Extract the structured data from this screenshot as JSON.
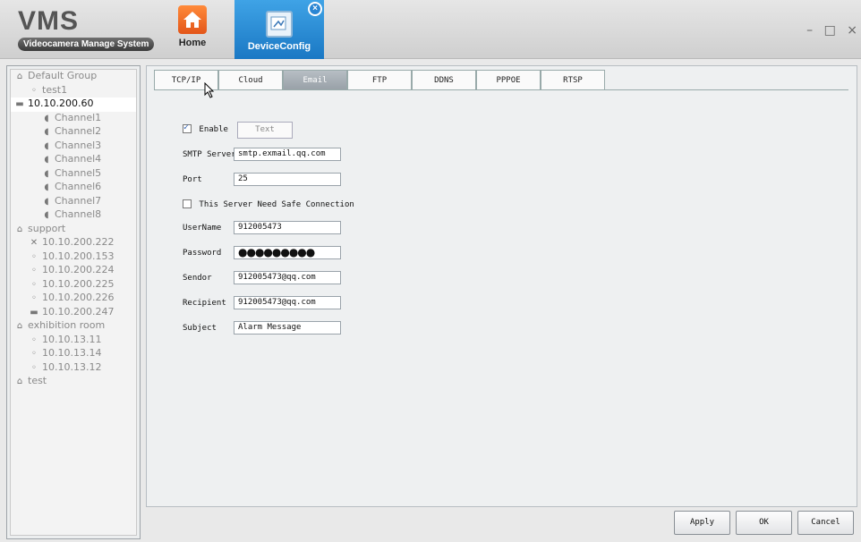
{
  "app": {
    "title": "VMS",
    "subtitle": "Videocamera Manage System",
    "window_controls": "– □ ×"
  },
  "nav": {
    "home_label": "Home",
    "devconfig_label": "DeviceConfig",
    "close_badge": "×"
  },
  "tree": [
    {
      "label": "Default Group",
      "level": 0,
      "icon": "group-icon"
    },
    {
      "label": "test1",
      "level": 1,
      "icon": "camera-icon"
    },
    {
      "label": "10.10.200.60",
      "level": 0,
      "icon": "nvr-icon",
      "selected": true
    },
    {
      "label": "Channel1",
      "level": 2,
      "icon": "channel-icon"
    },
    {
      "label": "Channel2",
      "level": 2,
      "icon": "channel-icon"
    },
    {
      "label": "Channel3",
      "level": 2,
      "icon": "channel-icon"
    },
    {
      "label": "Channel4",
      "level": 2,
      "icon": "channel-icon"
    },
    {
      "label": "Channel5",
      "level": 2,
      "icon": "channel-icon"
    },
    {
      "label": "Channel6",
      "level": 2,
      "icon": "channel-icon"
    },
    {
      "label": "Channel7",
      "level": 2,
      "icon": "channel-icon"
    },
    {
      "label": "Channel8",
      "level": 2,
      "icon": "channel-icon"
    },
    {
      "label": "support",
      "level": 0,
      "icon": "group-icon"
    },
    {
      "label": "10.10.200.222",
      "level": 1,
      "icon": "offline-icon"
    },
    {
      "label": "10.10.200.153",
      "level": 1,
      "icon": "camera-icon"
    },
    {
      "label": "10.10.200.224",
      "level": 1,
      "icon": "camera-icon"
    },
    {
      "label": "10.10.200.225",
      "level": 1,
      "icon": "camera-icon"
    },
    {
      "label": "10.10.200.226",
      "level": 1,
      "icon": "camera-icon"
    },
    {
      "label": "10.10.200.247",
      "level": 1,
      "icon": "nvr-icon"
    },
    {
      "label": "exhibition room",
      "level": 0,
      "icon": "group-icon"
    },
    {
      "label": "10.10.13.11",
      "level": 1,
      "icon": "camera-icon"
    },
    {
      "label": "10.10.13.14",
      "level": 1,
      "icon": "camera-icon"
    },
    {
      "label": "10.10.13.12",
      "level": 1,
      "icon": "camera-icon"
    },
    {
      "label": "test",
      "level": 0,
      "icon": "group-icon"
    }
  ],
  "tabs": [
    "TCP/IP",
    "Cloud",
    "Email",
    "FTP",
    "DDNS",
    "PPPOE",
    "RTSP"
  ],
  "active_tab": "Email",
  "email": {
    "enable_label": "Enable",
    "enable_checked": true,
    "test_button": "Text",
    "smtp_label": "SMTP Server",
    "smtp_value": "smtp.exmail.qq.com",
    "port_label": "Port",
    "port_value": "25",
    "safe_conn_label": "This Server Need Safe Connection",
    "safe_conn_checked": false,
    "username_label": "UserName",
    "username_value": "912005473",
    "password_label": "Password",
    "password_mask": "●●●●●●●●●",
    "sendor_label": "Sendor",
    "sendor_value": "912005473@qq.com",
    "recipient_label": "Recipient",
    "recipient_value": "912005473@qq.com",
    "subject_label": "Subject",
    "subject_value": "Alarm Message"
  },
  "buttons": {
    "apply": "Apply",
    "ok": "OK",
    "cancel": "Cancel"
  }
}
